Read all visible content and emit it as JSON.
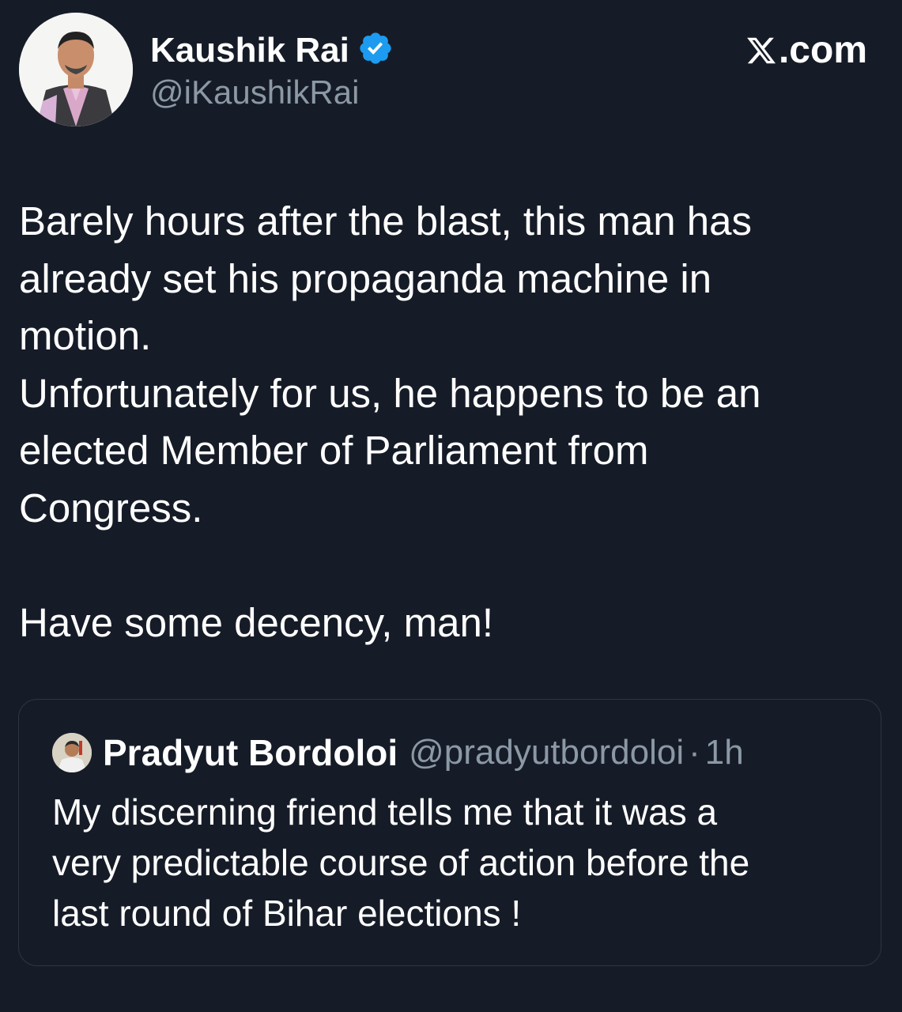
{
  "header": {
    "author_name": "Kaushik Rai",
    "author_handle": "@iKaushikRai",
    "verified_icon": "verified-badge-icon",
    "brand_text": ".com",
    "brand_logo_icon": "x-logo-icon"
  },
  "tweet": {
    "line_1": "Barely hours after the blast, this man has",
    "line_2": "already set his propaganda machine in",
    "line_3": "motion.",
    "line_4": "Unfortunately for us, he happens to be an",
    "line_5": "elected Member of Parliament from",
    "line_6": "Congress.",
    "line_7": "Have some decency, man!"
  },
  "quote": {
    "author_name": "Pradyut Bordoloi",
    "author_handle": "@pradyutbordoloi",
    "separator": "·",
    "time": "1h",
    "line_1": "My discerning friend tells me that it was a",
    "line_2": "very predictable course of action before the",
    "line_3": "last round of Bihar elections !"
  },
  "colors": {
    "background": "#161c27",
    "text": "#ffffff",
    "secondary_text": "#8b98a5",
    "verified_blue": "#1d9bf0",
    "border": "#2f3640"
  }
}
